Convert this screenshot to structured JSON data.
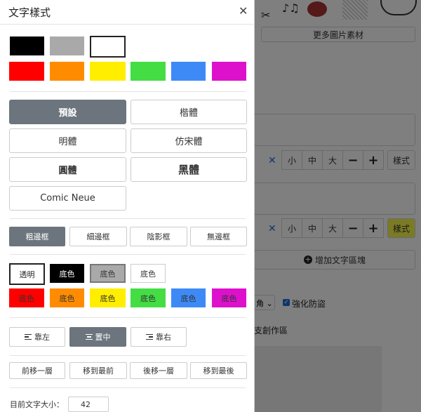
{
  "background": {
    "more_images_label": "更多圖片素材",
    "stepper": {
      "small": "小",
      "medium": "中",
      "large": "大",
      "minus": "−",
      "plus": "+"
    },
    "style_label": "樣式",
    "add_text_block_label": "增加文字區塊",
    "strengthen_label": "強化防盜",
    "corner_label": "角",
    "create_area_label": "支創作區"
  },
  "modal": {
    "title": "文字樣式",
    "text_colors": [
      "#000000",
      "#a9a9a9",
      "#ffffff",
      "#ff0000",
      "#ff8c00",
      "#ffee00",
      "#44dd44",
      "#3d8af7",
      "#dd11cc"
    ],
    "fonts": {
      "default": "預設",
      "kaiti": "楷體",
      "mingti": "明體",
      "fangsong": "仿宋體",
      "yuanti": "圓體",
      "heiti": "黑體",
      "comic": "Comic Neue"
    },
    "borders": {
      "thick": "粗邊框",
      "thin": "細邊框",
      "shadow": "陰影框",
      "none": "無邊框"
    },
    "bg": {
      "transparent": "透明",
      "label": "底色",
      "colors": [
        "#000000",
        "#a9a9a9",
        "#ffffff",
        "#ff0000",
        "#ff8c00",
        "#ffee00",
        "#44dd44",
        "#3d8af7",
        "#dd11cc"
      ]
    },
    "align": {
      "left": "靠左",
      "center": "置中",
      "right": "靠右"
    },
    "layers": {
      "forward": "前移一層",
      "front": "移到最前",
      "backward": "後移一層",
      "back": "移到最後"
    },
    "font_size_label": "目前文字大小：",
    "font_size_value": "42"
  }
}
